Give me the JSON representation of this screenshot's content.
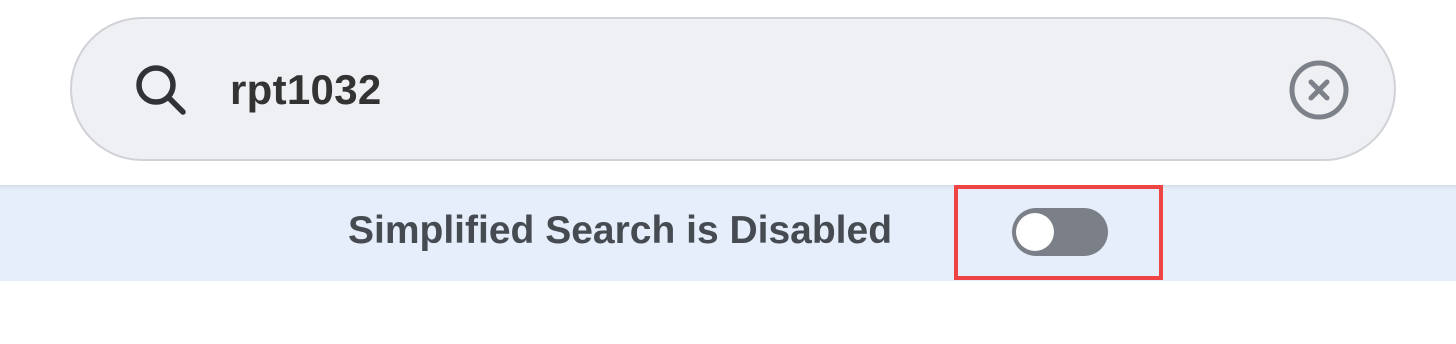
{
  "search": {
    "value": "rpt1032",
    "icon": "search-icon",
    "clear_icon": "clear-circle-x-icon"
  },
  "simplified_search": {
    "label": "Simplified Search is Disabled",
    "enabled": false
  },
  "colors": {
    "search_bg": "#eff0f3",
    "banner_bg": "#e6eefb",
    "toggle_off": "#7b7f88",
    "highlight": "#ef4444"
  }
}
